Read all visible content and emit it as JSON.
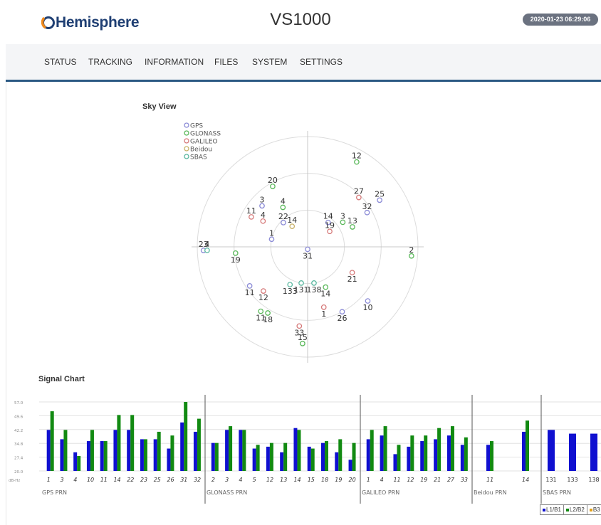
{
  "header": {
    "logo_text": "Hemisphere",
    "title": "VS1000",
    "datetime": "2020-01-23 06:29:06"
  },
  "nav": [
    "STATUS",
    "TRACKING",
    "INFORMATION",
    "FILES",
    "SYSTEM",
    "SETTINGS"
  ],
  "sky_view": {
    "title": "Sky View",
    "legend": [
      {
        "name": "GPS",
        "color": "#8b8bd6"
      },
      {
        "name": "GLONASS",
        "color": "#5ab85a"
      },
      {
        "name": "GALILEO",
        "color": "#d67a7a"
      },
      {
        "name": "Beidou",
        "color": "#c9b26a"
      },
      {
        "name": "SBAS",
        "color": "#5ab8a0"
      }
    ],
    "satellites": [
      {
        "prn": "12",
        "sys": "GLONASS",
        "az": 30,
        "el": 10
      },
      {
        "prn": "27",
        "sys": "GALILEO",
        "az": 46,
        "el": 32
      },
      {
        "prn": "25",
        "sys": "GPS",
        "az": 57,
        "el": 20
      },
      {
        "prn": "32",
        "sys": "GPS",
        "az": 60,
        "el": 34
      },
      {
        "prn": "3",
        "sys": "GLONASS",
        "az": 55,
        "el": 55
      },
      {
        "prn": "13",
        "sys": "GLONASS",
        "az": 66,
        "el": 50
      },
      {
        "prn": "14",
        "sys": "GPS",
        "az": 40,
        "el": 64
      },
      {
        "prn": "19",
        "sys": "GALILEO",
        "az": 55,
        "el": 68
      },
      {
        "prn": "20",
        "sys": "GLONASS",
        "az": 330,
        "el": 33
      },
      {
        "prn": "3",
        "sys": "GPS",
        "az": 312,
        "el": 40
      },
      {
        "prn": "4",
        "sys": "GLONASS",
        "az": 328,
        "el": 52
      },
      {
        "prn": "11",
        "sys": "GALILEO",
        "az": 298,
        "el": 38
      },
      {
        "prn": "22",
        "sys": "GPS",
        "az": 315,
        "el": 62
      },
      {
        "prn": "14",
        "sys": "Beidou",
        "az": 323,
        "el": 69
      },
      {
        "prn": "4",
        "sys": "GALILEO",
        "az": 300,
        "el": 48
      },
      {
        "prn": "1",
        "sys": "GPS",
        "az": 282,
        "el": 60
      },
      {
        "prn": "31",
        "sys": "GPS",
        "az": 180,
        "el": 88
      },
      {
        "prn": "23",
        "sys": "GPS",
        "az": 268,
        "el": 5
      },
      {
        "prn": "4",
        "sys": "SBAS",
        "az": 268,
        "el": 8
      },
      {
        "prn": "19",
        "sys": "GLONASS",
        "az": 265,
        "el": 31
      },
      {
        "prn": "2",
        "sys": "GLONASS",
        "az": 95,
        "el": 5
      },
      {
        "prn": "21",
        "sys": "GALILEO",
        "az": 120,
        "el": 48
      },
      {
        "prn": "10",
        "sys": "GPS",
        "az": 132,
        "el": 24
      },
      {
        "prn": "11",
        "sys": "GPS",
        "az": 236,
        "el": 33
      },
      {
        "prn": "12",
        "sys": "GALILEO",
        "az": 225,
        "el": 39
      },
      {
        "prn": "133",
        "sys": "SBAS",
        "az": 205,
        "el": 56
      },
      {
        "prn": "131",
        "sys": "SBAS",
        "az": 190,
        "el": 60
      },
      {
        "prn": "138",
        "sys": "SBAS",
        "az": 170,
        "el": 60
      },
      {
        "prn": "14",
        "sys": "GLONASS",
        "az": 156,
        "el": 54
      },
      {
        "prn": "11",
        "sys": "GLONASS",
        "az": 216,
        "el": 25
      },
      {
        "prn": "18",
        "sys": "GLONASS",
        "az": 211,
        "el": 27
      },
      {
        "prn": "1",
        "sys": "GALILEO",
        "az": 165,
        "el": 39
      },
      {
        "prn": "26",
        "sys": "GPS",
        "az": 152,
        "el": 30
      },
      {
        "prn": "33",
        "sys": "GALILEO",
        "az": 186,
        "el": 25
      },
      {
        "prn": "15",
        "sys": "GLONASS",
        "az": 183,
        "el": 11
      }
    ]
  },
  "signal_chart": {
    "title": "Signal Chart",
    "chart_data": {
      "type": "bar",
      "ylabel": "dB-Hz",
      "yticks": [
        "57.0",
        "49.6",
        "42.2",
        "34.8",
        "27.4",
        "20.0"
      ],
      "ylim": [
        20.0,
        57.0
      ],
      "groups": [
        {
          "label": "GPS PRN",
          "categories": [
            "1",
            "3",
            "4",
            "10",
            "11",
            "14",
            "22",
            "23",
            "25",
            "26",
            "31",
            "32"
          ],
          "L1": [
            42,
            37,
            30,
            36,
            36,
            42,
            42,
            37,
            37,
            32,
            46,
            41
          ],
          "L2": [
            52,
            42,
            28,
            42,
            36,
            50,
            50,
            37,
            41,
            39,
            57,
            48
          ]
        },
        {
          "label": "GLONASS PRN",
          "categories": [
            "2",
            "3",
            "4",
            "5",
            "12",
            "13",
            "14",
            "15",
            "18",
            "19",
            "20"
          ],
          "L1": [
            35,
            42,
            42,
            32,
            33,
            30,
            43,
            33,
            35,
            30,
            26
          ],
          "L2": [
            35,
            44,
            42,
            34,
            35,
            35,
            42,
            32,
            36,
            37,
            35
          ]
        },
        {
          "label": "GALILEO PRN",
          "categories": [
            "1",
            "4",
            "11",
            "12",
            "19",
            "21",
            "27",
            "33"
          ],
          "L1": [
            37,
            39,
            29,
            33,
            36,
            37,
            39,
            34
          ],
          "L2": [
            42,
            44,
            34,
            39,
            39,
            43,
            44,
            38
          ]
        },
        {
          "label": "Beidou PRN",
          "categories": [
            "11",
            "14"
          ],
          "L1": [
            34,
            41
          ],
          "L2": [
            36,
            47
          ]
        },
        {
          "label": "SBAS PRN",
          "categories": [
            "131",
            "133",
            "138"
          ],
          "L1": [
            42,
            40,
            40
          ],
          "L2": []
        }
      ],
      "series": [
        {
          "name": "L1/B1",
          "color": "#1010d0"
        },
        {
          "name": "L2/B2",
          "color": "#128a12"
        },
        {
          "name": "B3",
          "color": "#e3a21a"
        }
      ],
      "grid": true
    }
  }
}
